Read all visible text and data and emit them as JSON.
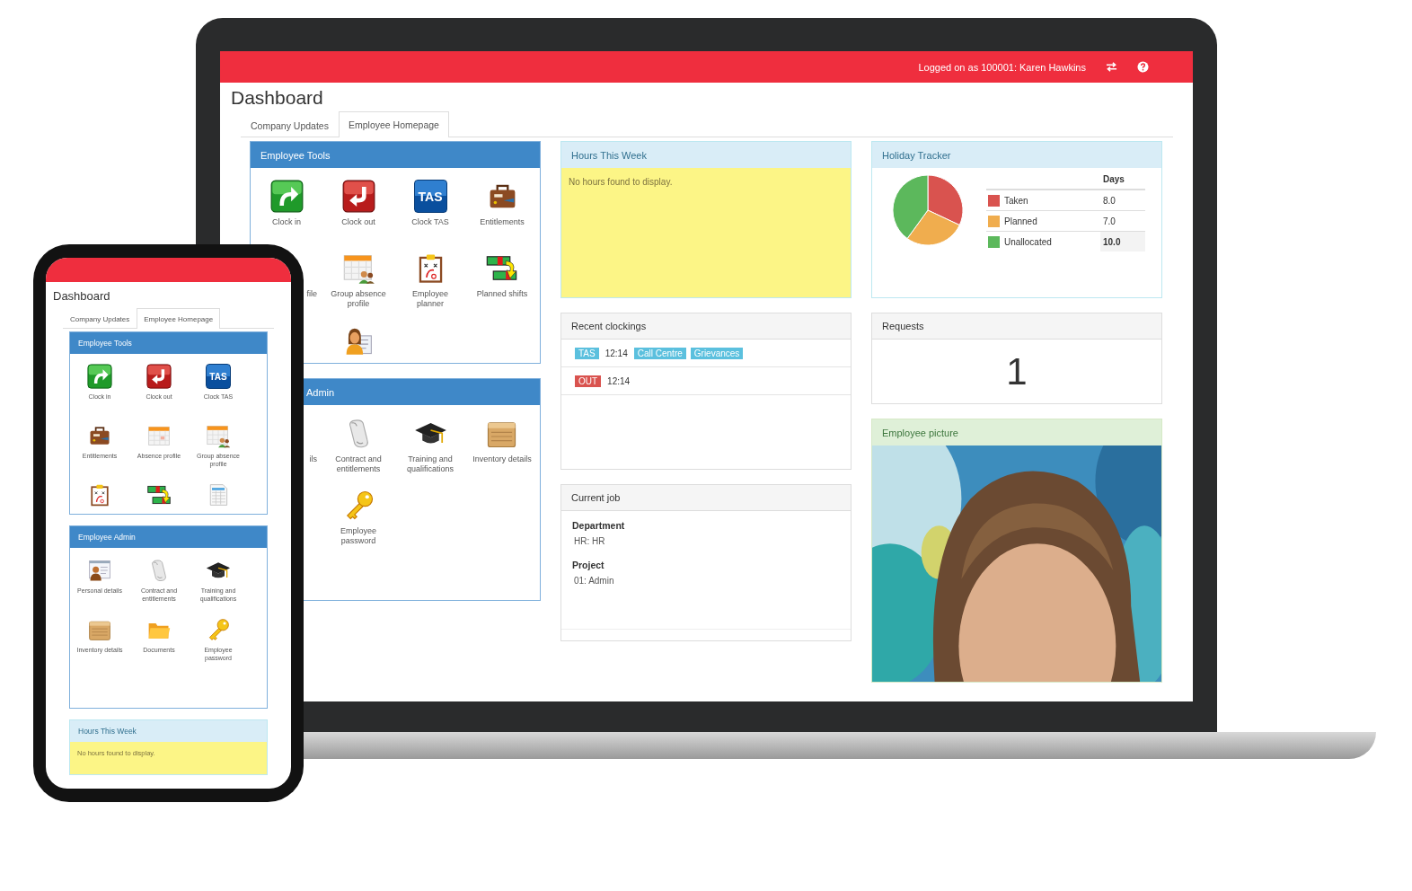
{
  "laptop": {
    "header": {
      "user": "Logged on as 100001: Karen Hawkins"
    },
    "title": "Dashboard",
    "tabs": [
      {
        "label": "Company Updates",
        "selected": false
      },
      {
        "label": "Employee Homepage",
        "selected": true
      }
    ],
    "columns": [
      [
        {
          "kind": "tools",
          "title": "Employee Tools",
          "partly_hidden": false,
          "items": [
            {
              "kind": "clockin",
              "label": "Clock in"
            },
            {
              "kind": "clockout",
              "label": "Clock out"
            },
            {
              "kind": "tas",
              "badge": "TAS",
              "label": "Clock TAS"
            },
            {
              "kind": "briefcase",
              "label": "Entitlements"
            },
            {
              "kind": "fragment",
              "label": "file"
            },
            {
              "kind": "groupcal",
              "label": "Group absence profile"
            },
            {
              "kind": "planner",
              "label": "Employee planner"
            },
            {
              "kind": "shifts",
              "label": "Planned shifts"
            },
            {
              "kind": "blank"
            },
            {
              "kind": "avatar"
            }
          ]
        },
        {
          "kind": "tools",
          "title": "Admin",
          "partly_hidden": true,
          "items": [
            {
              "kind": "fragment",
              "label": "ils"
            },
            {
              "kind": "scroll",
              "label": "Contract and entitlements"
            },
            {
              "kind": "cap",
              "label": "Training and qualifications"
            },
            {
              "kind": "crate",
              "label": "Inventory details"
            },
            {
              "kind": "blank"
            },
            {
              "kind": "key",
              "label": "Employee password"
            }
          ]
        }
      ],
      [
        {
          "kind": "note",
          "title": "Hours This Week",
          "text": "No hours found to display."
        },
        {
          "kind": "clockings",
          "title": "Recent clockings",
          "rows": [
            {
              "parts": [
                {
                  "kind": "tag",
                  "text": "TAS",
                  "color": "#5bc0de"
                },
                {
                  "kind": "time",
                  "text": "12:14"
                },
                {
                  "kind": "tag",
                  "text": "Call Centre",
                  "color": "#5bc0de"
                },
                {
                  "kind": "tag",
                  "text": "Grievances",
                  "color": "#5bc0de"
                }
              ]
            },
            {
              "parts": [
                {
                  "kind": "tag",
                  "text": "OUT",
                  "color": "#d9534f"
                },
                {
                  "kind": "time",
                  "text": "12:14"
                }
              ]
            }
          ]
        },
        {
          "kind": "job",
          "title": "Current job",
          "fields": [
            {
              "label": "Department",
              "value": "HR: HR"
            },
            {
              "label": "Project",
              "value": "01: Admin"
            }
          ]
        }
      ],
      [
        {
          "kind": "holiday",
          "title": "Holiday Tracker",
          "column_header": "Days",
          "rows": [
            {
              "value": "8.0",
              "color": "#d9534f",
              "emphasis": false
            },
            {
              "value": "7.0",
              "color": "#f0ad4e",
              "emphasis": false
            },
            {
              "value": "10.0",
              "color": "#5cb85c",
              "emphasis": true
            }
          ],
          "chart_data": {
            "type": "pie",
            "categories": [
              "Taken",
              "Planned",
              "Unallocated"
            ],
            "values": [
              32,
              28,
              40
            ]
          }
        },
        {
          "kind": "count",
          "title": "Requests",
          "value": "1"
        },
        {
          "kind": "picture",
          "title": "Employee picture"
        }
      ]
    ]
  },
  "phone": {
    "title": "Dashboard",
    "tabs": [
      {
        "label": "Company Updates",
        "selected": false
      },
      {
        "label": "Employee Homepage",
        "selected": true
      }
    ],
    "panels": [
      {
        "kind": "tools",
        "title": "Employee Tools",
        "items": [
          {
            "kind": "clockin",
            "label": "Clock in"
          },
          {
            "kind": "clockout",
            "label": "Clock out"
          },
          {
            "kind": "tas",
            "badge": "TAS",
            "label": "Clock TAS"
          },
          {
            "kind": "briefcase",
            "label": "Entitlements"
          },
          {
            "kind": "calendar",
            "label": "Absence profile"
          },
          {
            "kind": "groupcal",
            "label": "Group absence profile"
          },
          {
            "kind": "planner"
          },
          {
            "kind": "shifts"
          },
          {
            "kind": "sheet"
          }
        ]
      },
      {
        "kind": "tools",
        "title": "Employee Admin",
        "items": [
          {
            "kind": "card",
            "label": "Personal details"
          },
          {
            "kind": "scroll",
            "label": "Contract and entitlements"
          },
          {
            "kind": "cap",
            "label": "Training and qualifications"
          },
          {
            "kind": "crate",
            "label": "Inventory details"
          },
          {
            "kind": "folder",
            "label": "Documents"
          },
          {
            "kind": "key",
            "label": "Employee password"
          }
        ]
      },
      {
        "kind": "note",
        "title": "Hours This Week",
        "text": "No hours found to display."
      }
    ]
  }
}
